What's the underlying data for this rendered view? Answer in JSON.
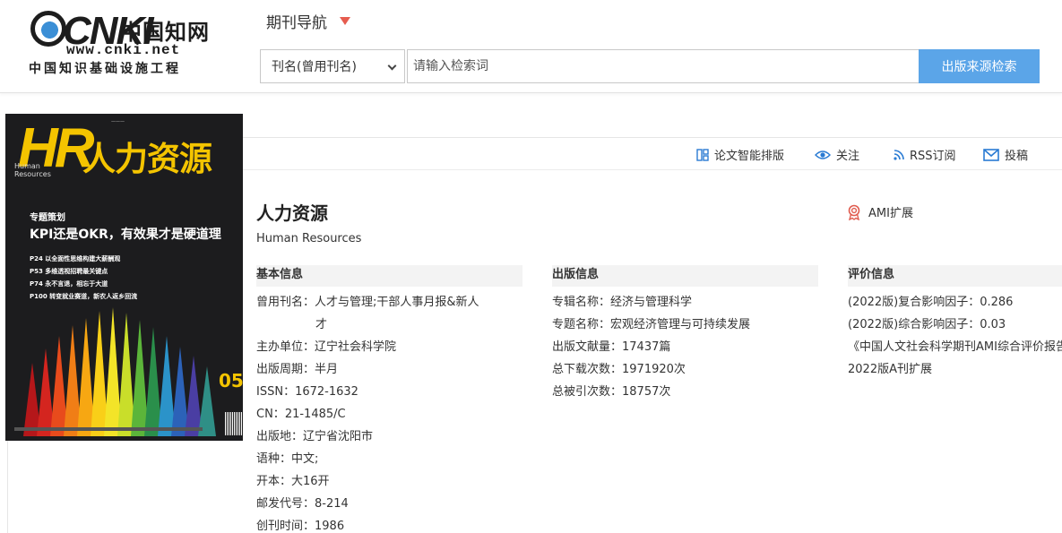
{
  "header": {
    "logo": {
      "brand": "CNKI",
      "brand_zh": "中国知网",
      "url": "www.cnki.net",
      "tagline": "中国知识基础设施工程"
    },
    "nav_title": "期刊导航",
    "search": {
      "field_selected": "刊名(曾用刊名)",
      "placeholder": "请输入检索词",
      "button": "出版来源检索"
    }
  },
  "toolbar": {
    "items": [
      {
        "label": "论文智能排版",
        "icon": "layout-icon"
      },
      {
        "label": "关注",
        "icon": "eye-icon"
      },
      {
        "label": "RSS订阅",
        "icon": "rss-icon"
      },
      {
        "label": "投稿",
        "icon": "mail-icon"
      }
    ]
  },
  "cover": {
    "brand": "HR",
    "title": "人力资源",
    "english": "Human Resources",
    "kicker": "专题策划",
    "headline": "KPI还是OKR，有效果才是硬道理",
    "lines": [
      "P24  以全面性思维构建大薪酬观",
      "P53  多维透视招聘最关键点",
      "P74  永不言退，相忘于大道",
      "P100 转变就业赛道，新农人返乡回流"
    ],
    "issue": "05"
  },
  "journal": {
    "title": "人力资源",
    "english": "Human Resources",
    "ami_label": "AMI扩展"
  },
  "basic": {
    "heading": "基本信息",
    "rows": [
      {
        "label": "曾用刊名：",
        "value": "人才与管理;干部人事月报&新人"
      },
      {
        "label": "",
        "value": "才"
      },
      {
        "label": "主办单位：",
        "value": "辽宁社会科学院"
      },
      {
        "label": "出版周期：",
        "value": "半月"
      },
      {
        "label": "ISSN：",
        "value": "1672-1632"
      },
      {
        "label": "CN：",
        "value": "21-1485/C"
      },
      {
        "label": "出版地：",
        "value": "辽宁省沈阳市"
      },
      {
        "label": "语种：",
        "value": "中文;"
      },
      {
        "label": "开本：",
        "value": "大16开"
      },
      {
        "label": "邮发代号：",
        "value": "8-214"
      },
      {
        "label": "创刊时间：",
        "value": "1986"
      }
    ]
  },
  "publish": {
    "heading": "出版信息",
    "rows": [
      {
        "label": "专辑名称：",
        "value": "经济与管理科学"
      },
      {
        "label": "专题名称：",
        "value": "宏观经济管理与可持续发展"
      },
      {
        "label": "出版文献量：",
        "value": "17437篇"
      },
      {
        "label": "总下载次数：",
        "value": "1971920次"
      },
      {
        "label": "总被引次数：",
        "value": "18757次"
      }
    ]
  },
  "evaluation": {
    "heading": "评价信息",
    "rows": [
      {
        "label": "(2022版)复合影响因子：",
        "value": "0.286"
      },
      {
        "label": "(2022版)综合影响因子：",
        "value": "0.03"
      },
      {
        "label": "",
        "value": "《中国人文社会科学期刊AMI综合评价报告"
      },
      {
        "label": "",
        "value": "2022版A刊扩展"
      }
    ]
  }
}
